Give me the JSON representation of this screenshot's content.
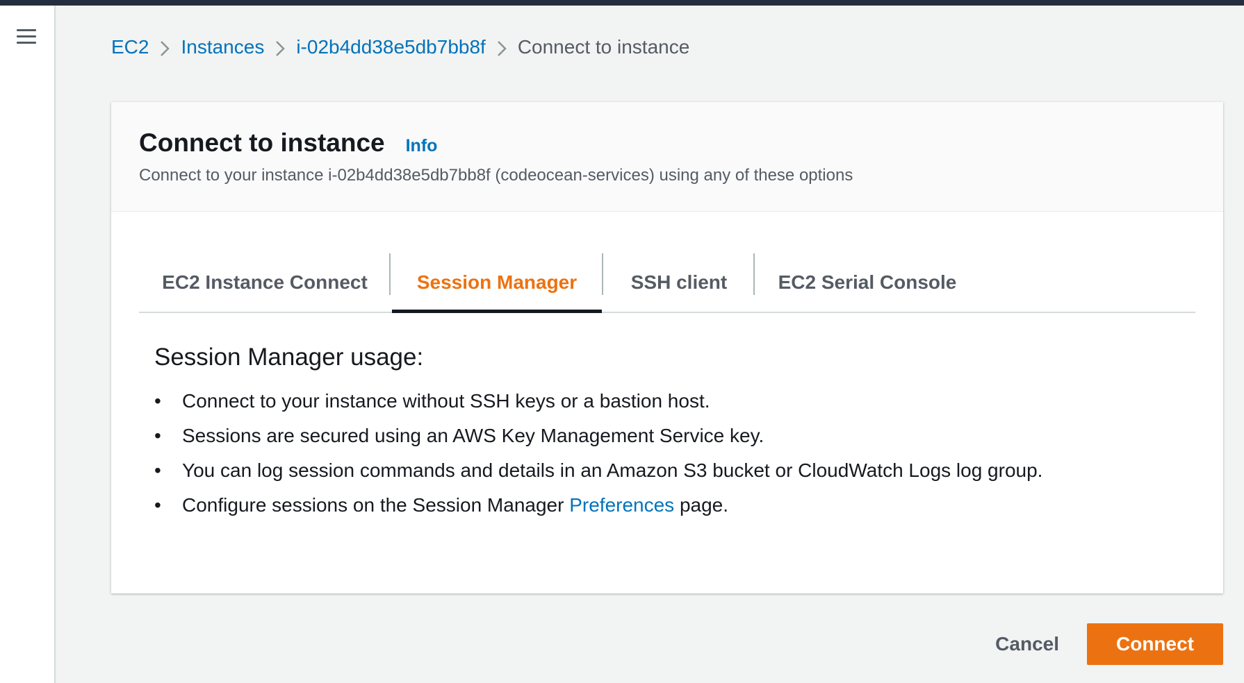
{
  "breadcrumb": {
    "items": [
      "EC2",
      "Instances",
      "i-02b4dd38e5db7bb8f"
    ],
    "current": "Connect to instance"
  },
  "panel": {
    "title": "Connect to instance",
    "info_label": "Info",
    "description": "Connect to your instance i-02b4dd38e5db7bb8f (codeocean-services) using any of these options"
  },
  "tabs": [
    {
      "label": "EC2 Instance Connect",
      "active": false
    },
    {
      "label": "Session Manager",
      "active": true
    },
    {
      "label": "SSH client",
      "active": false
    },
    {
      "label": "EC2 Serial Console",
      "active": false
    }
  ],
  "usage": {
    "heading": "Session Manager usage:",
    "bullets": [
      "Connect to your instance without SSH keys or a bastion host.",
      "Sessions are secured using an AWS Key Management Service key.",
      "You can log session commands and details in an Amazon S3 bucket or CloudWatch Logs log group."
    ],
    "last_bullet_prefix": "Configure sessions on the Session Manager ",
    "last_bullet_link": "Preferences",
    "last_bullet_suffix": " page."
  },
  "actions": {
    "cancel_label": "Cancel",
    "connect_label": "Connect"
  },
  "colors": {
    "accent": "#ec7211",
    "link": "#0073bb",
    "topbar": "#232f3e"
  },
  "icons": [
    "menu-icon",
    "chevron-right-icon"
  ]
}
